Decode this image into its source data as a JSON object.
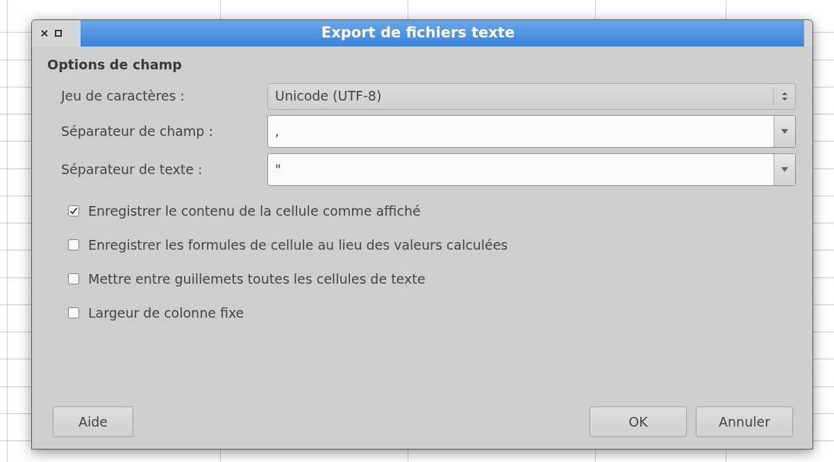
{
  "window": {
    "title": "Export de fichiers texte"
  },
  "section_title": "Options de champ",
  "fields": [
    {
      "label": "Jeu de caractères :",
      "value": "Unicode (UTF-8)",
      "kind": "list"
    },
    {
      "label": "Séparateur de champ :",
      "value": ",",
      "kind": "combo"
    },
    {
      "label": "Séparateur de texte :",
      "value": "\"",
      "kind": "combo"
    }
  ],
  "options": [
    {
      "label": "Enregistrer le contenu de la cellule comme affiché",
      "checked": true
    },
    {
      "label": "Enregistrer les formules de cellule au lieu des valeurs calculées",
      "checked": false
    },
    {
      "label": "Mettre entre guillemets toutes les cellules de texte",
      "checked": false
    },
    {
      "label": "Largeur de colonne fixe",
      "checked": false
    }
  ],
  "buttons_left": [
    "Aide"
  ],
  "buttons_right": [
    "OK",
    "Annuler"
  ]
}
